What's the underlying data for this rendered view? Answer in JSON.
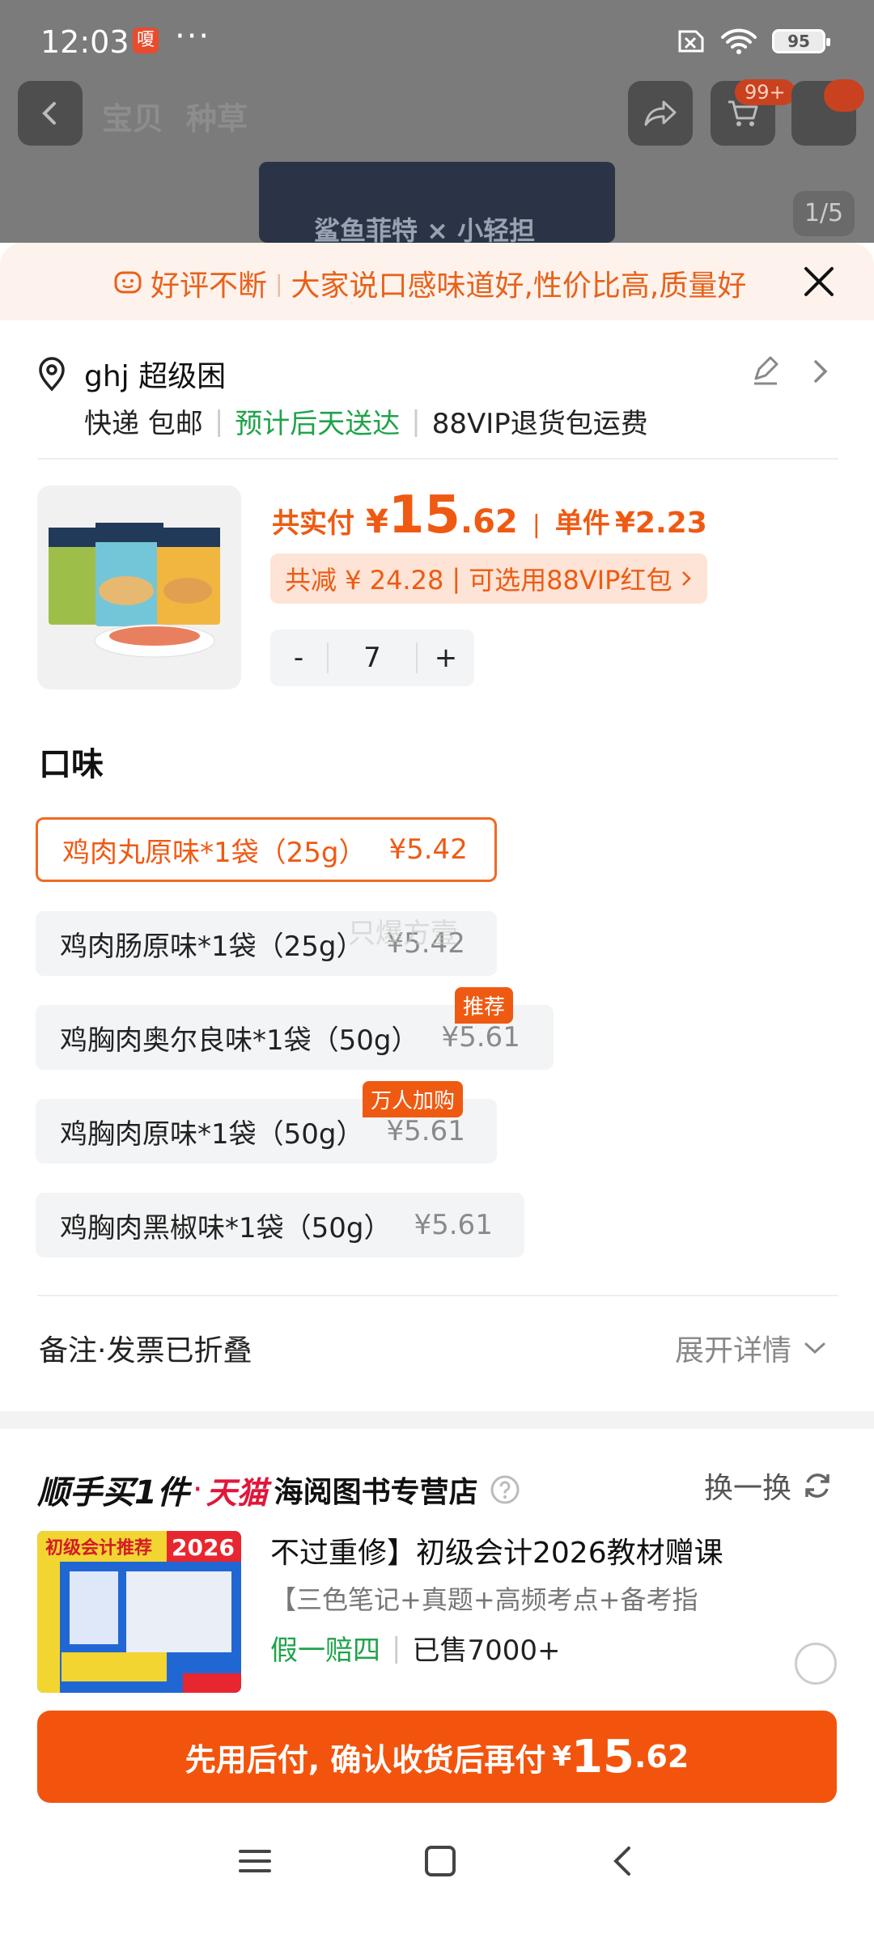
{
  "status": {
    "time": "12:03",
    "app_badge": "嗄",
    "dots": "···",
    "battery": "95"
  },
  "background": {
    "tabs": [
      "宝贝",
      "种草"
    ],
    "cart_badge": "99+",
    "product_text": "鲨鱼菲特 × 小轻担",
    "page_indicator": "1/5"
  },
  "review_banner": {
    "label": "好评不断",
    "text": "大家说口感味道好,性价比高,质量好"
  },
  "address": {
    "name": "ghj 超级困",
    "shipping": "快递 包邮",
    "delivery": "预计后天送达",
    "return": "88VIP退货包运费"
  },
  "price": {
    "total_label": "共实付",
    "currency": "¥",
    "total_int": "15",
    "total_dec": ".62",
    "unit_label": "单件",
    "unit_value": "¥2.23",
    "discount": "共减 ¥ 24.28",
    "vip": "可选用88VIP红包",
    "quantity": "7",
    "minus": "-",
    "plus": "+"
  },
  "flavor": {
    "title": "口味",
    "options": [
      {
        "name": "鸡肉丸原味*1袋（25g）",
        "price": "¥5.42"
      },
      {
        "name": "鸡肉肠原味*1袋（25g）",
        "price": "¥5.42"
      },
      {
        "name": "鸡胸肉奥尔良味*1袋（50g）",
        "price": "¥5.61",
        "tag": "推荐"
      },
      {
        "name": "鸡胸肉原味*1袋（50g）",
        "price": "¥5.61",
        "tag": "万人加购"
      },
      {
        "name": "鸡胸肉黑椒味*1袋（50g）",
        "price": "¥5.61"
      }
    ],
    "watermark": "只爆方壹"
  },
  "notes": {
    "label": "备注·发票已折叠",
    "expand": "展开详情"
  },
  "recommend": {
    "title": "顺手买1件",
    "brand": "天猫",
    "store": "海阅图书专营店",
    "swap": "换一换",
    "book_title": "不过重修】初级会计2026教材赠课",
    "book_sub": "【三色笔记+真题+高频考点+备考指",
    "badge": "假一赔四",
    "sold": "已售7000+",
    "cover_year": "2026",
    "cover_text": "初级会计推荐"
  },
  "pay": {
    "label": "先用后付, 确认收货后再付",
    "currency": "¥",
    "int": "15",
    "dec": ".62"
  },
  "colors": {
    "accent": "#f3540d",
    "green": "#1fa34a",
    "tmall": "#e0173b"
  }
}
